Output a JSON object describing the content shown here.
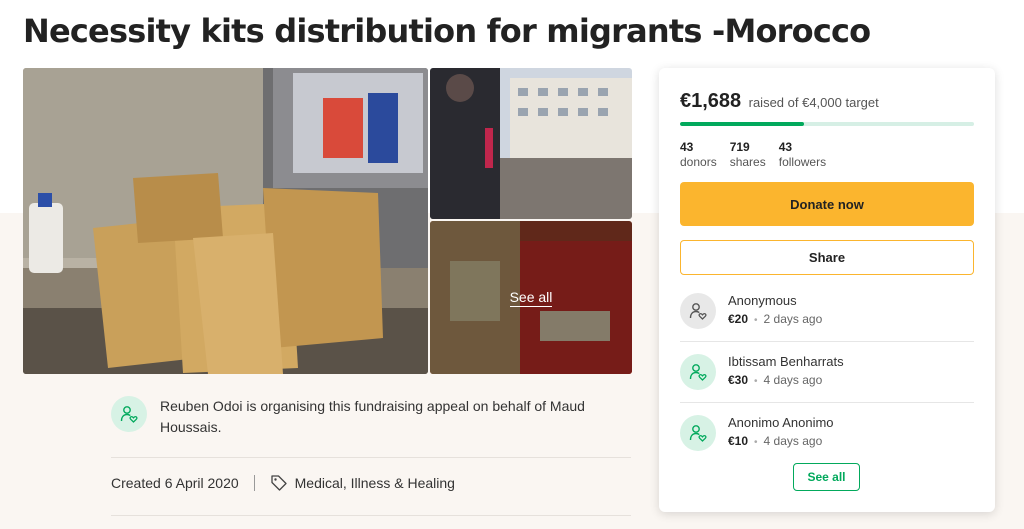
{
  "campaign": {
    "title": "Necessity kits distribution for migrants -Morocco"
  },
  "gallery": {
    "see_all_label": "See all",
    "photos": [
      "bags-on-pavement",
      "woman-on-street",
      "food-packages"
    ]
  },
  "organiser": {
    "text": "Reuben Odoi is organising this fundraising appeal on behalf of Maud Houssais.",
    "icon": "person-heart-icon"
  },
  "meta": {
    "created": "Created 6 April 2020",
    "category": "Medical, Illness & Healing",
    "category_icon": "tag-icon"
  },
  "donation_card": {
    "raised": "€1,688",
    "target_text": "raised of €4,000 target",
    "progress_fraction": 0.422,
    "stats": [
      {
        "num": "43",
        "label": "donors"
      },
      {
        "num": "719",
        "label": "shares"
      },
      {
        "num": "43",
        "label": "followers"
      }
    ],
    "donate_label": "Donate now",
    "share_label": "Share",
    "donations": [
      {
        "name": "Anonymous",
        "amount": "€20",
        "time": "2 days ago",
        "icon": "anonymous-donor-icon"
      },
      {
        "name": "Ibtissam Benharrats",
        "amount": "€30",
        "time": "4 days ago",
        "icon": "donor-heart-icon"
      },
      {
        "name": "Anonimo Anonimo",
        "amount": "€10",
        "time": "4 days ago",
        "icon": "donor-heart-icon"
      }
    ],
    "see_all_label": "See all"
  },
  "colors": {
    "accent_green": "#02a95c",
    "donate_yellow": "#fbb52e",
    "background_beige": "#faf6f2"
  }
}
